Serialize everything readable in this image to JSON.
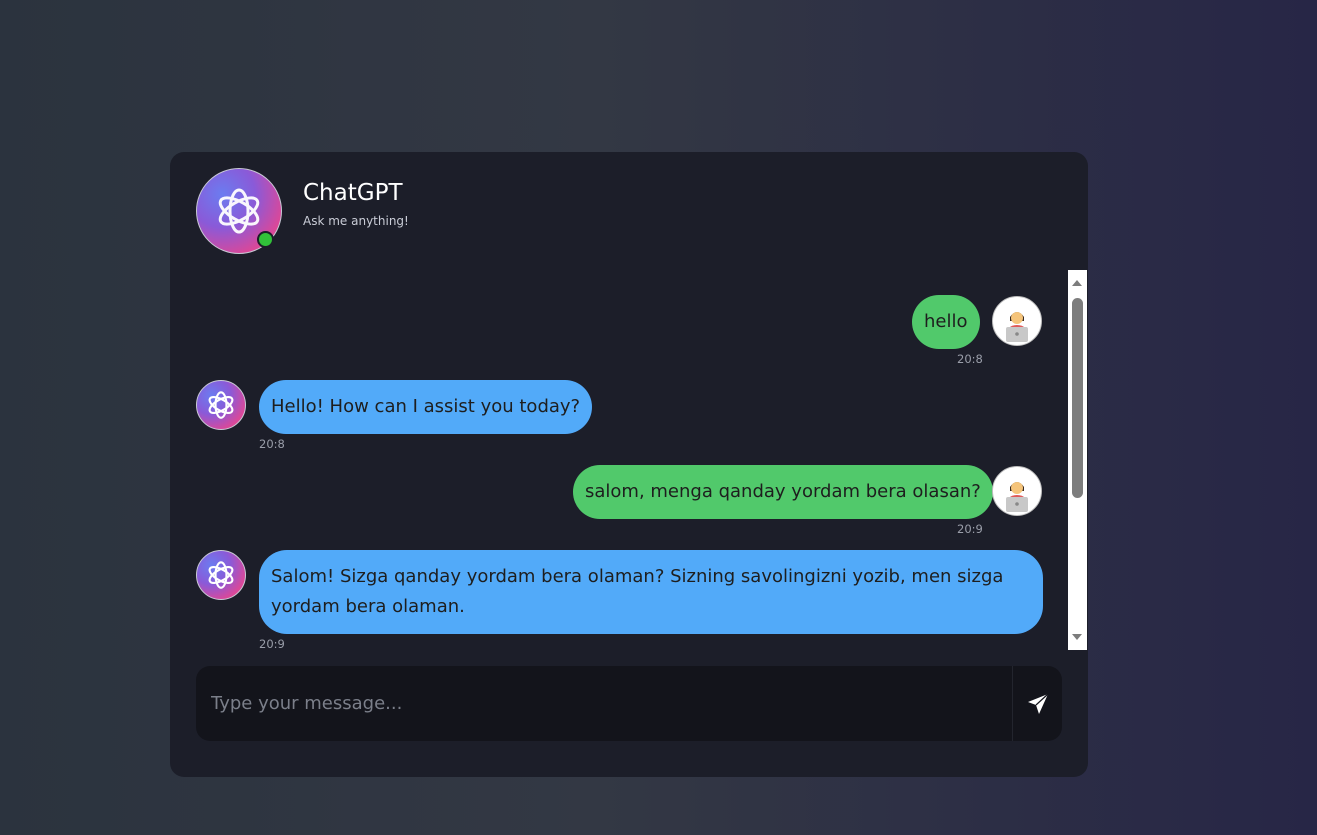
{
  "header": {
    "title": "ChatGPT",
    "subtitle": "Ask me anything!",
    "status": "online",
    "avatar_icon": "openai-logo-icon"
  },
  "messages": [
    {
      "sender": "user",
      "text": "hello",
      "time": "20:8"
    },
    {
      "sender": "bot",
      "text": "Hello! How can I assist you today?",
      "time": "20:8"
    },
    {
      "sender": "user",
      "text": "salom, menga qanday yordam bera olasan?",
      "time": "20:9"
    },
    {
      "sender": "bot",
      "text": "Salom! Sizga qanday yordam bera olaman? Sizning savolingizni yozib, men sizga yordam bera olaman.",
      "time": "20:9"
    }
  ],
  "composer": {
    "placeholder": "Type your message...",
    "send_icon": "send-icon"
  },
  "colors": {
    "user_bubble": "#51c96b",
    "bot_bubble": "#52aaf9",
    "online": "#31c139",
    "panel": "#1c1e29"
  }
}
